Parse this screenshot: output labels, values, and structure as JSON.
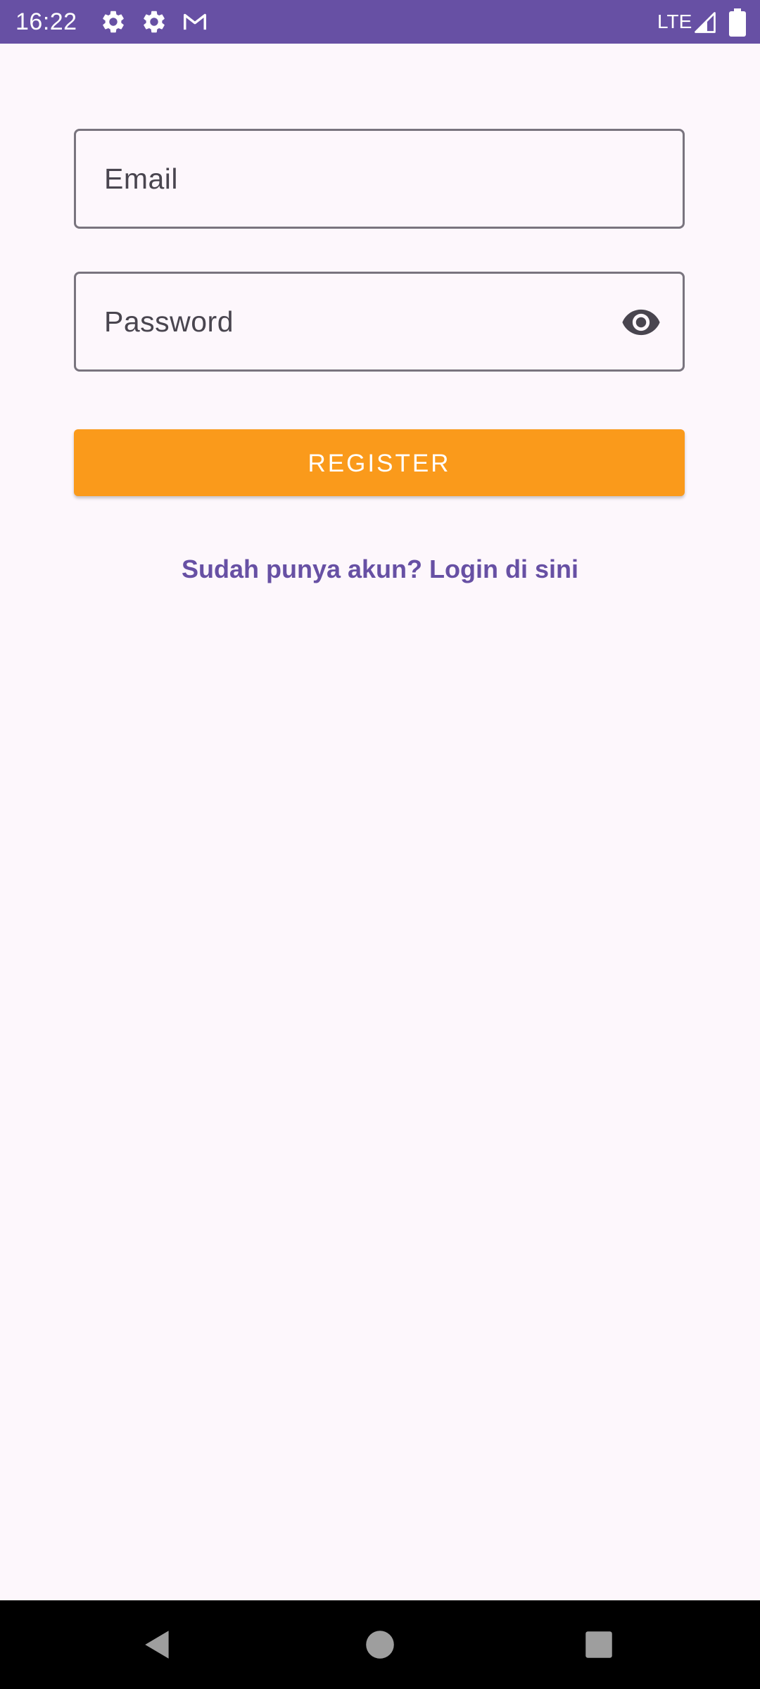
{
  "status_bar": {
    "time": "16:22",
    "network": "LTE",
    "background_color": "#6750A4",
    "icons": [
      "settings-gear-icon",
      "settings-gear-icon",
      "gmail-icon",
      "cellular-signal-icon",
      "battery-icon"
    ]
  },
  "form": {
    "email": {
      "placeholder": "Email",
      "value": ""
    },
    "password": {
      "placeholder": "Password",
      "value": "",
      "toggle_icon": "eye-icon"
    },
    "register_label": "REGISTER",
    "login_link": "Sudah punya akun? Login di sini"
  },
  "colors": {
    "background": "#FDF7FC",
    "accent": "#FA9A1B",
    "link": "#6750A4",
    "field_border": "#79747E"
  },
  "nav_bar": {
    "buttons": [
      "back-icon",
      "home-icon",
      "recents-icon"
    ]
  }
}
